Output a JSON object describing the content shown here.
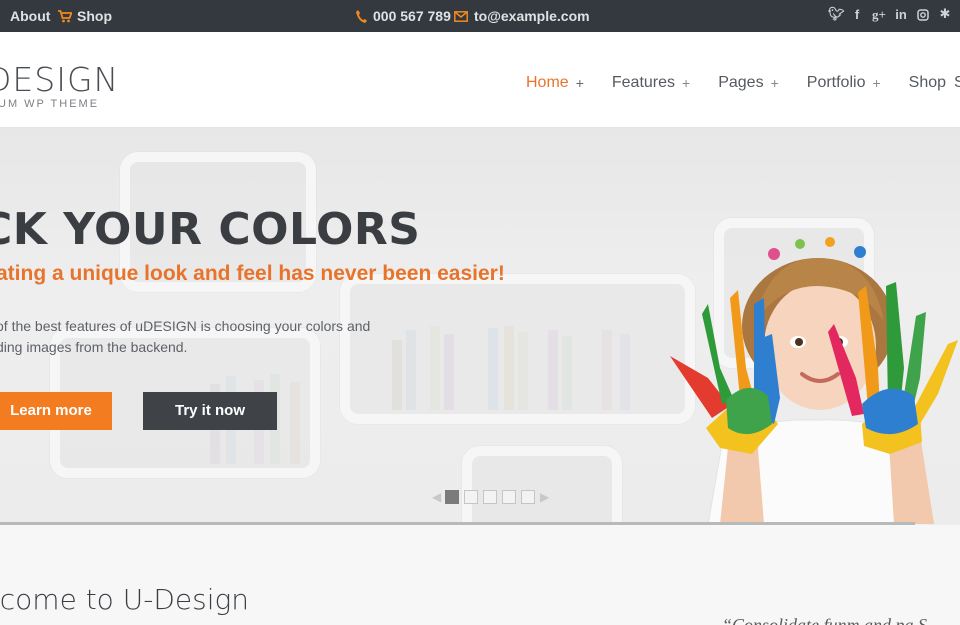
{
  "topbar": {
    "about_label": "About",
    "shop_label": "Shop",
    "phone": "000 567 789",
    "email": "to@example.com",
    "social_icons": [
      "twitter-icon",
      "facebook-icon",
      "google-plus-icon",
      "linkedin-icon",
      "instagram-icon",
      "yelp-icon",
      "skype-icon"
    ]
  },
  "header": {
    "logo_text": "DESIGN",
    "logo_tagline": "UM WP THEME",
    "nav": [
      {
        "label": "Home",
        "active": true,
        "has_sub": true
      },
      {
        "label": "Features",
        "active": false,
        "has_sub": true
      },
      {
        "label": "Pages",
        "active": false,
        "has_sub": true
      },
      {
        "label": "Portfolio",
        "active": false,
        "has_sub": true
      },
      {
        "label": "Shop",
        "active": false,
        "has_sub": false
      }
    ],
    "nav_cut": "S"
  },
  "slider": {
    "title": "CK YOUR COLORS",
    "subtitle": "ating a unique look and feel has never been easier!",
    "description_line1": "of the best features of uDESIGN is choosing your colors and",
    "description_line2": "ding images from the backend.",
    "learn_more_label": "Learn more",
    "try_label": "Try it now",
    "slide_count": 5,
    "active_slide": 1
  },
  "welcome": {
    "title": "lcome to U-Design",
    "quote_start": "“Consolidate funm and pa S"
  },
  "colors": {
    "accent": "#e8742c",
    "topbar": "#343940",
    "button_dark": "#3f4247"
  }
}
